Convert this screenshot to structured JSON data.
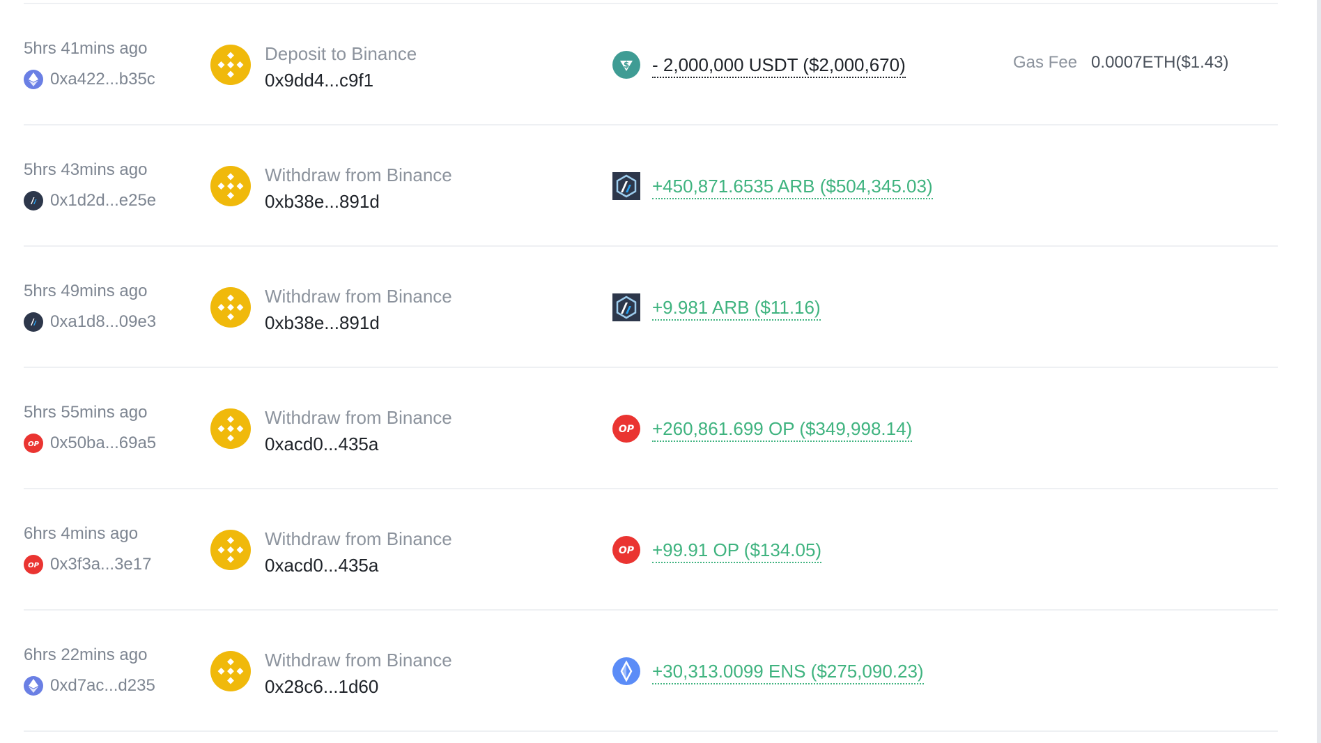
{
  "colors": {
    "binance": "#f0b90b",
    "positive": "#3fb37f",
    "negative": "#1f2329",
    "muted": "#7d8591",
    "divider": "#eef0f3"
  },
  "rows": [
    {
      "time": "5hrs 41mins ago",
      "chain_icon": "ethereum-icon",
      "address": "0xa422...b35c",
      "entity_icon": "binance-logo-icon",
      "action": "Deposit to Binance",
      "counterparty": "0x9dd4...c9f1",
      "token_icon": "usdt-icon",
      "amount": "- 2,000,000 USDT ($2,000,670)",
      "gas_label": "Gas Fee",
      "gas_value": "0.0007ETH($1.43)"
    },
    {
      "time": "5hrs 43mins ago",
      "chain_icon": "arbitrum-icon",
      "address": "0x1d2d...e25e",
      "entity_icon": "binance-logo-icon",
      "action": "Withdraw from Binance",
      "counterparty": "0xb38e...891d",
      "token_icon": "arb-token-icon",
      "amount": "+450,871.6535 ARB ($504,345.03)"
    },
    {
      "time": "5hrs 49mins ago",
      "chain_icon": "arbitrum-icon",
      "address": "0xa1d8...09e3",
      "entity_icon": "binance-logo-icon",
      "action": "Withdraw from Binance",
      "counterparty": "0xb38e...891d",
      "token_icon": "arb-token-icon",
      "amount": "+9.981 ARB ($11.16)"
    },
    {
      "time": "5hrs 55mins ago",
      "chain_icon": "optimism-icon",
      "address": "0x50ba...69a5",
      "entity_icon": "binance-logo-icon",
      "action": "Withdraw from Binance",
      "counterparty": "0xacd0...435a",
      "token_icon": "op-token-icon",
      "amount": "+260,861.699 OP ($349,998.14)"
    },
    {
      "time": "6hrs 4mins ago",
      "chain_icon": "optimism-icon",
      "address": "0x3f3a...3e17",
      "entity_icon": "binance-logo-icon",
      "action": "Withdraw from Binance",
      "counterparty": "0xacd0...435a",
      "token_icon": "op-token-icon",
      "amount": "+99.91 OP ($134.05)"
    },
    {
      "time": "6hrs 22mins ago",
      "chain_icon": "ethereum-icon",
      "address": "0xd7ac...d235",
      "entity_icon": "binance-logo-icon",
      "action": "Withdraw from Binance",
      "counterparty": "0x28c6...1d60",
      "token_icon": "ens-token-icon",
      "amount": "+30,313.0099 ENS ($275,090.23)"
    }
  ]
}
